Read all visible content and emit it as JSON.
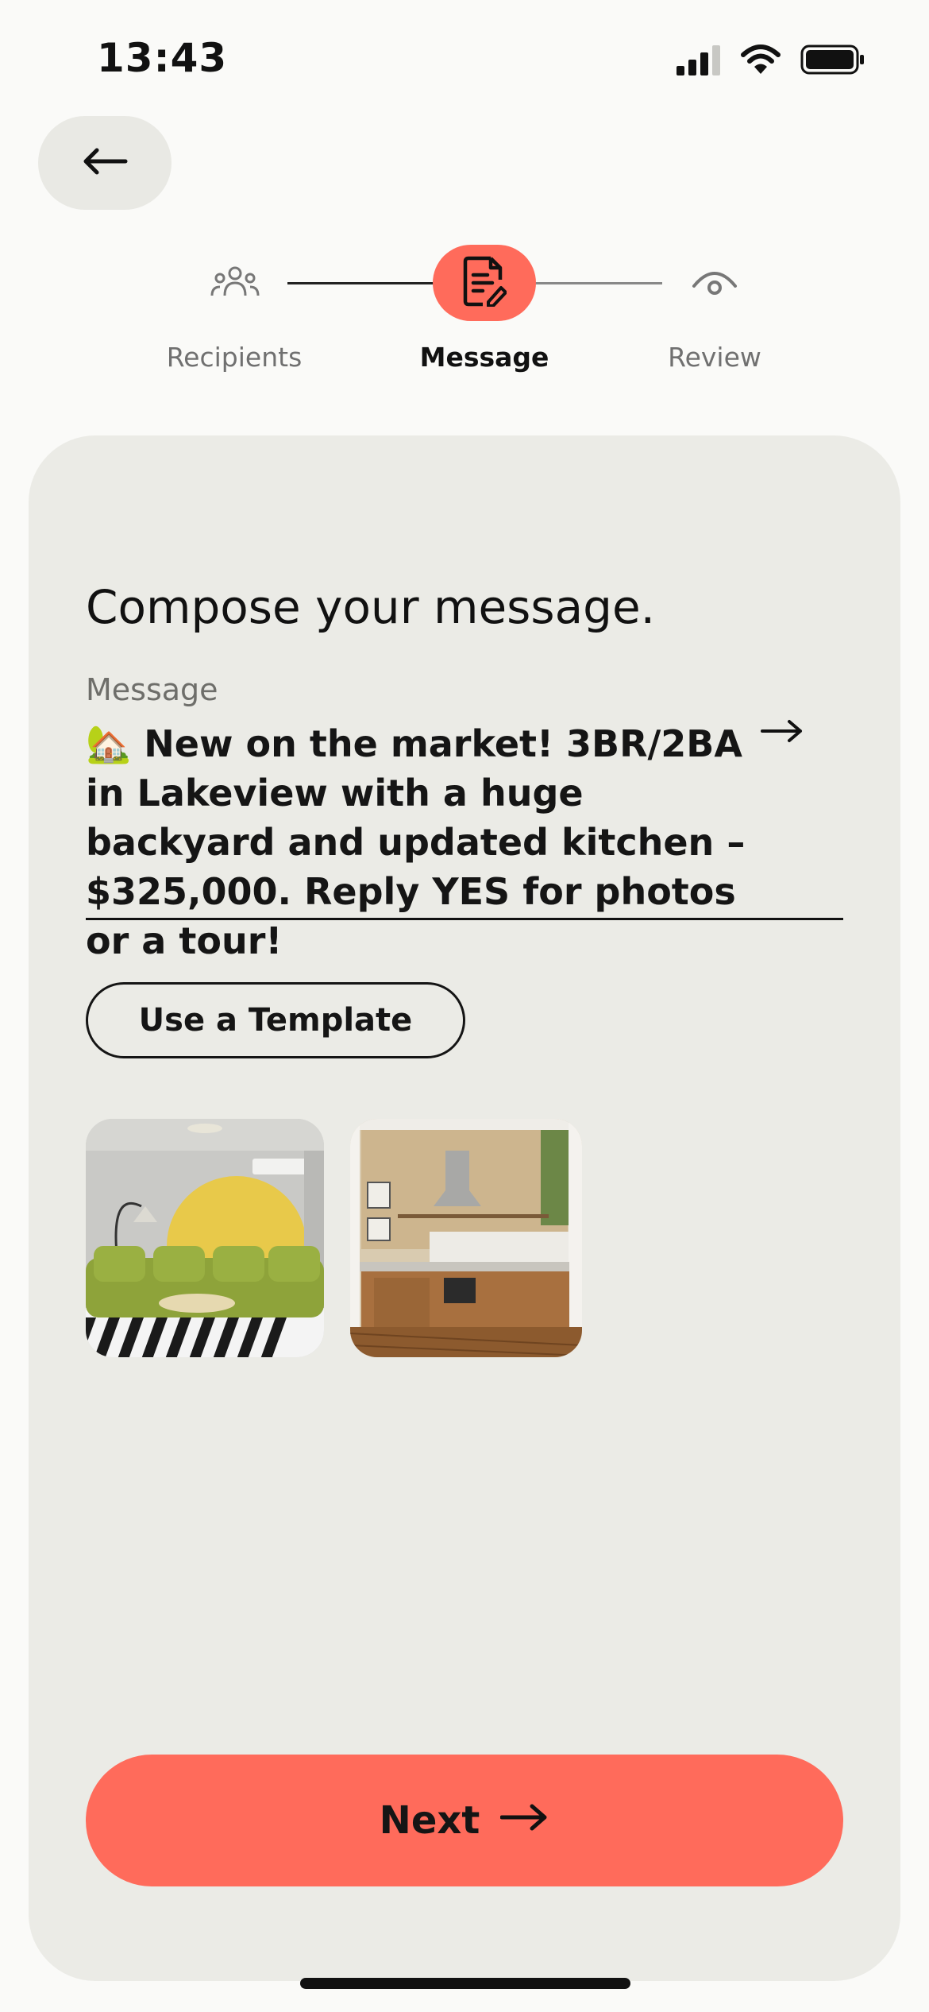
{
  "status_bar": {
    "time": "13:43"
  },
  "stepper": {
    "steps": [
      {
        "label": "Recipients",
        "icon": "people-icon",
        "state": "done"
      },
      {
        "label": "Message",
        "icon": "document-edit-icon",
        "state": "active"
      },
      {
        "label": "Review",
        "icon": "eye-icon",
        "state": "upcoming"
      }
    ]
  },
  "composer": {
    "heading": "Compose your message.",
    "field_label": "Message",
    "message": "🏡 New on the market! 3BR/2BA in Lakeview with a huge backyard and updated kitchen – $325,000. Reply YES for photos or a tour!",
    "template_button": "Use a Template",
    "attachments": [
      {
        "icon": "living-room-photo"
      },
      {
        "icon": "kitchen-photo"
      }
    ]
  },
  "footer": {
    "next_label": "Next"
  },
  "colors": {
    "accent": "#FF6B5B",
    "background": "#FAFAF8",
    "card": "#EBEBE6",
    "text": "#111111",
    "muted": "#6E6E6A"
  }
}
